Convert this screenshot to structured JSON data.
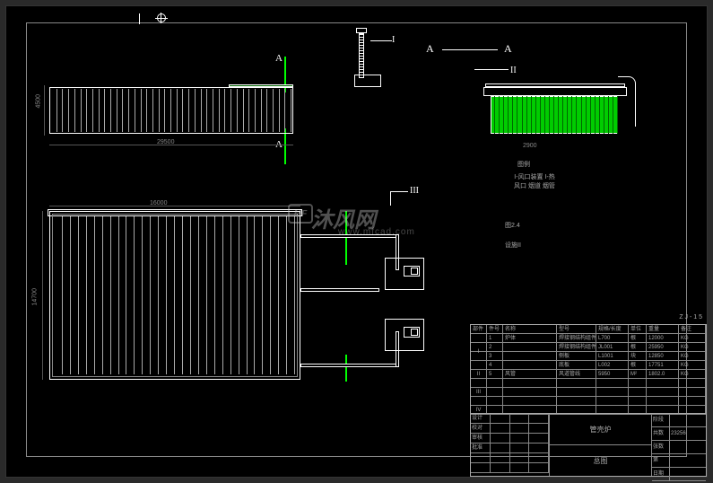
{
  "labels": {
    "section_a": "A",
    "callout_i": "I",
    "callout_ii": "II",
    "callout_iii": "III"
  },
  "dimensions": {
    "elev1_width": "29500",
    "elev1_height": "4500",
    "elev2_note": "2900",
    "plan_width": "16000",
    "plan_height": "14700"
  },
  "notes": {
    "n1": "图例",
    "n2": "I-风口装置\nI-热风口\n烟道\n烟管",
    "n3": "图2.4",
    "n4": "设施II"
  },
  "watermark": {
    "logo": "MF",
    "text": "沐风网",
    "url": "www.mfcad.com"
  },
  "title_block": {
    "code": "Z J - 1 5",
    "headers": [
      "部件",
      "件号",
      "名称",
      "型号",
      "规格/长度",
      "单位",
      "重量",
      "备注"
    ],
    "groups": [
      "I",
      "II",
      "III",
      "IV"
    ],
    "group_labels": [
      "炉体",
      "风道",
      "",
      ""
    ],
    "rows": [
      [
        "",
        "1",
        "炉体",
        "焊接钢结构组件",
        "L700",
        "根",
        "12000",
        "KG"
      ],
      [
        "",
        "2",
        "",
        "焊接钢结构组件",
        "JL001",
        "根",
        "25950",
        "KG"
      ],
      [
        "",
        "3",
        "",
        "侧板",
        "L1001",
        "块",
        "12850",
        "KG"
      ],
      [
        "",
        "4",
        "",
        "底板",
        "L002",
        "根",
        "17751",
        "KG"
      ],
      [
        "",
        "5",
        "风管",
        "风道管线",
        "5950",
        "M²",
        "1802.0",
        "KG"
      ],
      [
        "",
        "",
        "",
        "",
        "",
        "",
        "",
        ""
      ],
      [
        "",
        "",
        "",
        "",
        "",
        "",
        "",
        ""
      ],
      [
        "",
        "",
        "",
        "",
        "",
        "",
        "",
        ""
      ],
      [
        "",
        "",
        "",
        "",
        "",
        "",
        "",
        ""
      ]
    ],
    "bottom_left": [
      "设计",
      "校对",
      "审核",
      "批准"
    ],
    "project": "管壳炉",
    "drawing": "总图",
    "right_fields": [
      [
        "阶段",
        ""
      ],
      [
        "共数",
        "23256"
      ],
      [
        "张数",
        ""
      ],
      [
        "第",
        ""
      ],
      [
        "日期",
        ""
      ]
    ]
  }
}
